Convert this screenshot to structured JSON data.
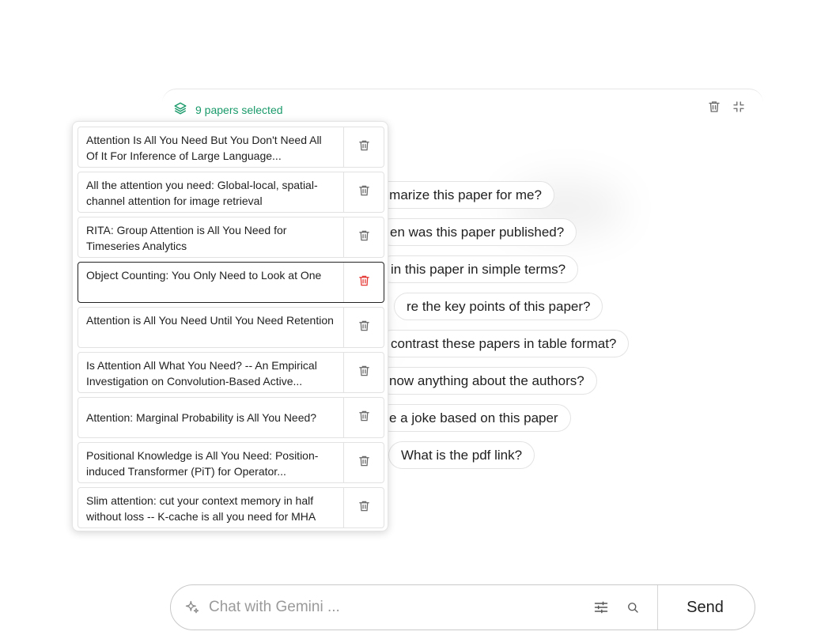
{
  "selection": {
    "label": "9 papers selected",
    "accent_color": "#1a9a6b",
    "icon": "layers-icon"
  },
  "panel_actions": {
    "delete_icon": "trash-icon",
    "collapse_icon": "collapse-icon"
  },
  "suggestions": [
    "mmarize this paper for me?",
    "en was this paper published?",
    "in this paper in simple terms?",
    "re the key points of this paper?",
    "contrast these papers in table format?",
    "now anything about the authors?",
    "e a joke based on this paper",
    "What is the pdf link?"
  ],
  "papers": [
    {
      "title": "Attention Is All You Need But You Don't Need All Of It For Inference of Large Language...",
      "active": false
    },
    {
      "title": "All the attention you need: Global-local, spatial-channel attention for image retrieval",
      "active": false
    },
    {
      "title": "RITA: Group Attention is All You Need for Timeseries Analytics",
      "active": false
    },
    {
      "title": "Object Counting: You Only Need to Look at One",
      "active": true
    },
    {
      "title": "Attention is All You Need Until You Need Retention",
      "active": false
    },
    {
      "title": "Is Attention All What You Need? -- An Empirical Investigation on Convolution-Based Active...",
      "active": false
    },
    {
      "title": "Attention: Marginal Probability is All You Need?",
      "active": false
    },
    {
      "title": "Positional Knowledge is All You Need: Position-induced Transformer (PiT) for Operator...",
      "active": false
    },
    {
      "title": "Slim attention: cut your context memory in half without loss -- K-cache is all you need for MHA",
      "active": false
    }
  ],
  "chat": {
    "placeholder": "Chat with Gemini ...",
    "value": "",
    "send_label": "Send",
    "sparkle_icon": "sparkle-icon",
    "tune_icon": "tune-icon",
    "search_icon": "search-icon"
  },
  "colors": {
    "delete_active": "#e53935",
    "icon_gray": "#6b6b6b"
  }
}
